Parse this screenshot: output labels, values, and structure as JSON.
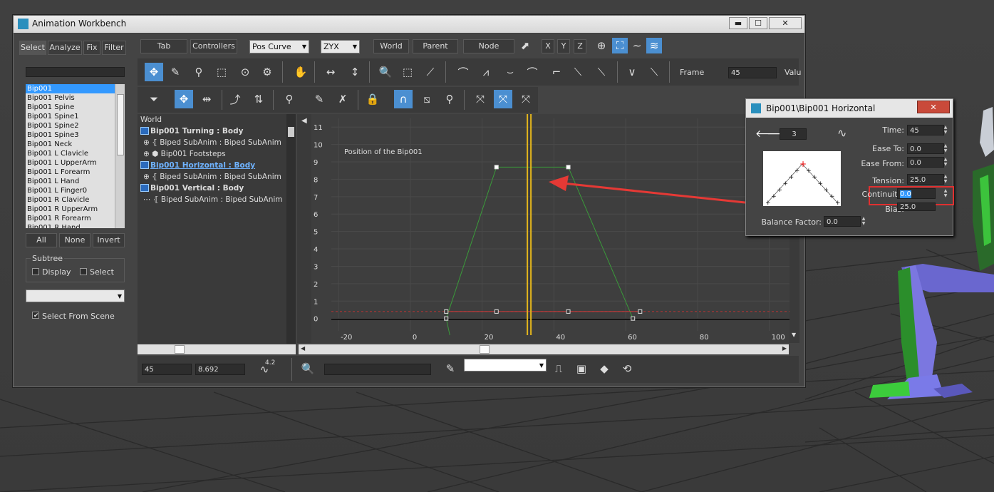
{
  "window": {
    "title": "Animation Workbench",
    "min": "▬",
    "max": "☐",
    "close": "✕"
  },
  "tabs": [
    "Select",
    "Analyze",
    "Fix",
    "Filter"
  ],
  "toolbar_top": {
    "tab_btn": "Tab",
    "controllers_btn": "Controllers",
    "curve_select": "Pos Curve",
    "axis_select": "ZYX",
    "world_btn": "World",
    "parent_btn": "Parent",
    "node_btn": "Node",
    "x_btn": "X",
    "y_btn": "Y",
    "z_btn": "Z"
  },
  "frame": {
    "label": "Frame",
    "value": "45",
    "value_label": "Valu"
  },
  "bone_list": [
    "Bip001",
    "Bip001 Pelvis",
    "Bip001 Spine",
    "Bip001 Spine1",
    "Bip001 Spine2",
    "Bip001 Spine3",
    "Bip001 Neck",
    "Bip001 L Clavicle",
    "Bip001 L UpperArm",
    "Bip001 L Forearm",
    "Bip001 L Hand",
    "Bip001 L Finger0",
    "Bip001 R Clavicle",
    "Bip001 R UpperArm",
    "Bip001 R Forearm",
    "Bip001 R Hand"
  ],
  "list_buttons": {
    "all": "All",
    "none": "None",
    "invert": "Invert"
  },
  "subtree": {
    "title": "Subtree",
    "display": "Display",
    "select": "Select"
  },
  "select_from_scene": "Select From Scene",
  "tree": {
    "world": "World",
    "rows": [
      "Bip001 Turning : Body",
      "Biped SubAnim   : Biped SubAnim",
      "Bip001 Footsteps",
      "Bip001 Horizontal : Body",
      "Biped SubAnim   : Biped SubAnim",
      "Bip001 Vertical : Body",
      "Biped SubAnim   : Biped SubAnim"
    ]
  },
  "chart_data": {
    "type": "line",
    "title": "Position of the Bip001",
    "xticks": [
      "-20",
      "0",
      "20",
      "40",
      "60",
      "80",
      "100"
    ],
    "yticks": [
      "0",
      "1",
      "2",
      "3",
      "4",
      "5",
      "6",
      "7",
      "8",
      "9",
      "10",
      "11"
    ],
    "xlim": [
      -22,
      108
    ],
    "ylim": [
      -0.3,
      11.5
    ],
    "current_frame": 33,
    "series": [
      {
        "color": "#3a9a3a",
        "x": [
          10,
          24,
          44,
          62
        ],
        "y": [
          0,
          8.7,
          8.7,
          0
        ]
      },
      {
        "color": "#d03a3a",
        "x": [
          10,
          24,
          44,
          64
        ],
        "y": [
          0.4,
          0.4,
          0.4,
          0.4
        ]
      }
    ]
  },
  "bottom": {
    "frame_field": "45",
    "value_field": "8.692",
    "scale_label": "4.2"
  },
  "dialog": {
    "title": "Bip001\\Bip001 Horizontal",
    "key_number": "3",
    "time_label": "Time:",
    "time": "45",
    "ease_to_label": "Ease To:",
    "ease_to": "0.0",
    "ease_from_label": "Ease From:",
    "ease_from": "0.0",
    "tension_label": "Tension:",
    "tension": "25.0",
    "continuity_label": "Continuity:",
    "continuity": "0.0",
    "bias_label": "Bias:",
    "bias": "25.0",
    "balance_label": "Balance Factor:",
    "balance": "0.0"
  },
  "colors": {
    "accent": "#4b8fd1",
    "highlight_box": "#e03030",
    "arrow": "#e53935"
  }
}
